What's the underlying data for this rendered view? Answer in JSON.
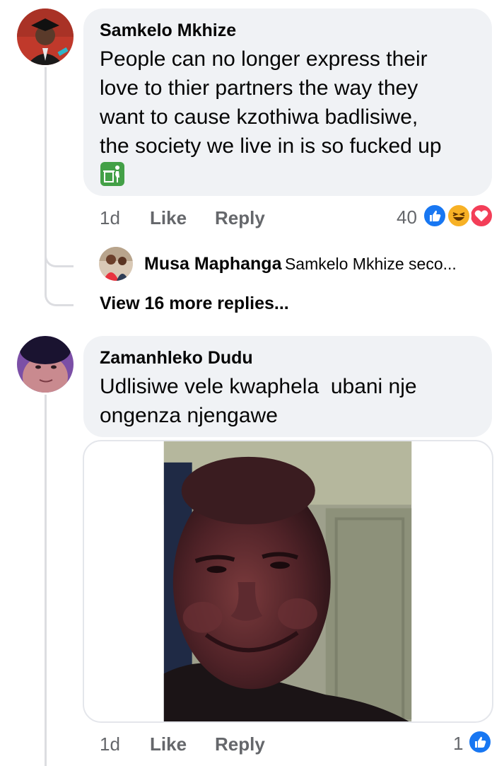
{
  "comments": [
    {
      "author": "Samkelo Mkhize",
      "text_lines": [
        "People can no longer express their",
        "love to thier partners the way they",
        "want to cause kzothiwa badlisiwe,",
        "the society we live in is so fucked up"
      ],
      "emoji_icon": "litter-bin-icon",
      "time": "1d",
      "like_label": "Like",
      "reply_label": "Reply",
      "reaction_count": "40",
      "reactions": [
        "like-icon",
        "haha-icon",
        "love-icon"
      ],
      "reply_preview": {
        "author": "Musa Maphanga",
        "text": "Samkelo Mkhize seco..."
      },
      "view_more_label": "View 16 more replies..."
    },
    {
      "author": "Zamanhleko Dudu",
      "text_lines": [
        "Udlisiwe vele kwaphela  ubani nje",
        "ongenza njengawe"
      ],
      "attachment": "photo-of-smiling-man",
      "time": "1d",
      "like_label": "Like",
      "reply_label": "Reply",
      "reaction_count": "1",
      "reactions": [
        "like-icon"
      ]
    }
  ],
  "colors": {
    "bubble": "#f0f2f5",
    "meta_text": "#65676b",
    "like_blue": "#1877f2",
    "love_red": "#f33e58",
    "haha_yellow": "#f7b125"
  }
}
